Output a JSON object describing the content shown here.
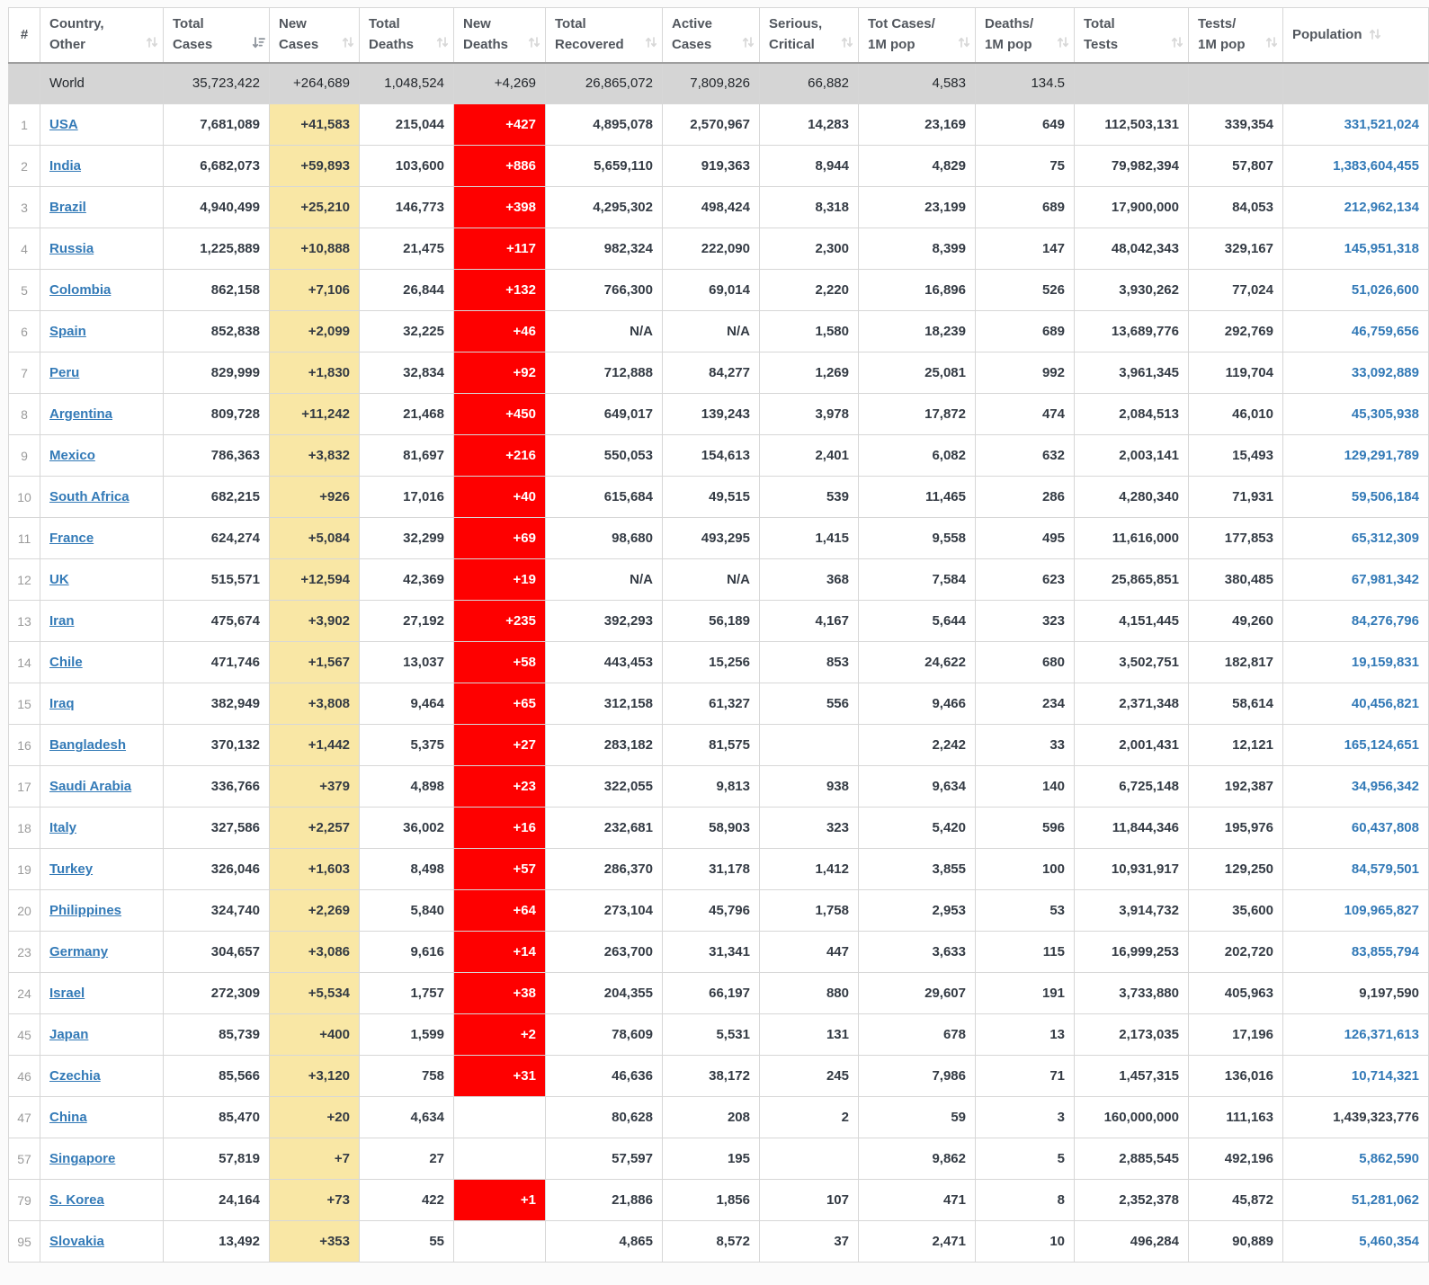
{
  "table": {
    "columns": [
      {
        "id": "rank",
        "label": "#",
        "sortable": false,
        "icon": null
      },
      {
        "id": "country",
        "label": "Country,\nOther",
        "sortable": true,
        "icon": "sort-both-icon"
      },
      {
        "id": "total_cases",
        "label": "Total\nCases",
        "sortable": true,
        "icon": "sort-desc-icon"
      },
      {
        "id": "new_cases",
        "label": "New\nCases",
        "sortable": true,
        "icon": "sort-both-icon"
      },
      {
        "id": "total_deaths",
        "label": "Total\nDeaths",
        "sortable": true,
        "icon": "sort-both-icon"
      },
      {
        "id": "new_deaths",
        "label": "New\nDeaths",
        "sortable": true,
        "icon": "sort-both-icon"
      },
      {
        "id": "total_recovered",
        "label": "Total\nRecovered",
        "sortable": true,
        "icon": "sort-both-icon"
      },
      {
        "id": "active_cases",
        "label": "Active\nCases",
        "sortable": true,
        "icon": "sort-both-icon"
      },
      {
        "id": "serious_critical",
        "label": "Serious,\nCritical",
        "sortable": true,
        "icon": "sort-both-icon"
      },
      {
        "id": "cases_per_1m",
        "label": "Tot Cases/\n1M pop",
        "sortable": true,
        "icon": "sort-both-icon"
      },
      {
        "id": "deaths_per_1m",
        "label": "Deaths/\n1M pop",
        "sortable": true,
        "icon": "sort-both-icon"
      },
      {
        "id": "total_tests",
        "label": "Total\nTests",
        "sortable": true,
        "icon": "sort-both-icon"
      },
      {
        "id": "tests_per_1m",
        "label": "Tests/\n1M pop",
        "sortable": true,
        "icon": "sort-both-icon"
      },
      {
        "id": "population",
        "label": "Population",
        "sortable": true,
        "icon": "sort-both-icon",
        "icon_inline": true
      }
    ],
    "world_row": {
      "rank": "",
      "country": "World",
      "total_cases": "35,723,422",
      "new_cases": "+264,689",
      "total_deaths": "1,048,524",
      "new_deaths": "+4,269",
      "total_recovered": "26,865,072",
      "active_cases": "7,809,826",
      "serious_critical": "66,882",
      "cases_per_1m": "4,583",
      "deaths_per_1m": "134.5",
      "total_tests": "",
      "tests_per_1m": "",
      "population": "",
      "population_is_link": false
    },
    "rows": [
      {
        "rank": "1",
        "country": "USA",
        "total_cases": "7,681,089",
        "new_cases": "+41,583",
        "total_deaths": "215,044",
        "new_deaths": "+427",
        "total_recovered": "4,895,078",
        "active_cases": "2,570,967",
        "serious_critical": "14,283",
        "cases_per_1m": "23,169",
        "deaths_per_1m": "649",
        "total_tests": "112,503,131",
        "tests_per_1m": "339,354",
        "population": "331,521,024",
        "population_is_link": true
      },
      {
        "rank": "2",
        "country": "India",
        "total_cases": "6,682,073",
        "new_cases": "+59,893",
        "total_deaths": "103,600",
        "new_deaths": "+886",
        "total_recovered": "5,659,110",
        "active_cases": "919,363",
        "serious_critical": "8,944",
        "cases_per_1m": "4,829",
        "deaths_per_1m": "75",
        "total_tests": "79,982,394",
        "tests_per_1m": "57,807",
        "population": "1,383,604,455",
        "population_is_link": true
      },
      {
        "rank": "3",
        "country": "Brazil",
        "total_cases": "4,940,499",
        "new_cases": "+25,210",
        "total_deaths": "146,773",
        "new_deaths": "+398",
        "total_recovered": "4,295,302",
        "active_cases": "498,424",
        "serious_critical": "8,318",
        "cases_per_1m": "23,199",
        "deaths_per_1m": "689",
        "total_tests": "17,900,000",
        "tests_per_1m": "84,053",
        "population": "212,962,134",
        "population_is_link": true
      },
      {
        "rank": "4",
        "country": "Russia",
        "total_cases": "1,225,889",
        "new_cases": "+10,888",
        "total_deaths": "21,475",
        "new_deaths": "+117",
        "total_recovered": "982,324",
        "active_cases": "222,090",
        "serious_critical": "2,300",
        "cases_per_1m": "8,399",
        "deaths_per_1m": "147",
        "total_tests": "48,042,343",
        "tests_per_1m": "329,167",
        "population": "145,951,318",
        "population_is_link": true
      },
      {
        "rank": "5",
        "country": "Colombia",
        "total_cases": "862,158",
        "new_cases": "+7,106",
        "total_deaths": "26,844",
        "new_deaths": "+132",
        "total_recovered": "766,300",
        "active_cases": "69,014",
        "serious_critical": "2,220",
        "cases_per_1m": "16,896",
        "deaths_per_1m": "526",
        "total_tests": "3,930,262",
        "tests_per_1m": "77,024",
        "population": "51,026,600",
        "population_is_link": true
      },
      {
        "rank": "6",
        "country": "Spain",
        "total_cases": "852,838",
        "new_cases": "+2,099",
        "total_deaths": "32,225",
        "new_deaths": "+46",
        "total_recovered": "N/A",
        "active_cases": "N/A",
        "serious_critical": "1,580",
        "cases_per_1m": "18,239",
        "deaths_per_1m": "689",
        "total_tests": "13,689,776",
        "tests_per_1m": "292,769",
        "population": "46,759,656",
        "population_is_link": true
      },
      {
        "rank": "7",
        "country": "Peru",
        "total_cases": "829,999",
        "new_cases": "+1,830",
        "total_deaths": "32,834",
        "new_deaths": "+92",
        "total_recovered": "712,888",
        "active_cases": "84,277",
        "serious_critical": "1,269",
        "cases_per_1m": "25,081",
        "deaths_per_1m": "992",
        "total_tests": "3,961,345",
        "tests_per_1m": "119,704",
        "population": "33,092,889",
        "population_is_link": true
      },
      {
        "rank": "8",
        "country": "Argentina",
        "total_cases": "809,728",
        "new_cases": "+11,242",
        "total_deaths": "21,468",
        "new_deaths": "+450",
        "total_recovered": "649,017",
        "active_cases": "139,243",
        "serious_critical": "3,978",
        "cases_per_1m": "17,872",
        "deaths_per_1m": "474",
        "total_tests": "2,084,513",
        "tests_per_1m": "46,010",
        "population": "45,305,938",
        "population_is_link": true
      },
      {
        "rank": "9",
        "country": "Mexico",
        "total_cases": "786,363",
        "new_cases": "+3,832",
        "total_deaths": "81,697",
        "new_deaths": "+216",
        "total_recovered": "550,053",
        "active_cases": "154,613",
        "serious_critical": "2,401",
        "cases_per_1m": "6,082",
        "deaths_per_1m": "632",
        "total_tests": "2,003,141",
        "tests_per_1m": "15,493",
        "population": "129,291,789",
        "population_is_link": true
      },
      {
        "rank": "10",
        "country": "South Africa",
        "total_cases": "682,215",
        "new_cases": "+926",
        "total_deaths": "17,016",
        "new_deaths": "+40",
        "total_recovered": "615,684",
        "active_cases": "49,515",
        "serious_critical": "539",
        "cases_per_1m": "11,465",
        "deaths_per_1m": "286",
        "total_tests": "4,280,340",
        "tests_per_1m": "71,931",
        "population": "59,506,184",
        "population_is_link": true
      },
      {
        "rank": "11",
        "country": "France",
        "total_cases": "624,274",
        "new_cases": "+5,084",
        "total_deaths": "32,299",
        "new_deaths": "+69",
        "total_recovered": "98,680",
        "active_cases": "493,295",
        "serious_critical": "1,415",
        "cases_per_1m": "9,558",
        "deaths_per_1m": "495",
        "total_tests": "11,616,000",
        "tests_per_1m": "177,853",
        "population": "65,312,309",
        "population_is_link": true
      },
      {
        "rank": "12",
        "country": "UK",
        "total_cases": "515,571",
        "new_cases": "+12,594",
        "total_deaths": "42,369",
        "new_deaths": "+19",
        "total_recovered": "N/A",
        "active_cases": "N/A",
        "serious_critical": "368",
        "cases_per_1m": "7,584",
        "deaths_per_1m": "623",
        "total_tests": "25,865,851",
        "tests_per_1m": "380,485",
        "population": "67,981,342",
        "population_is_link": true
      },
      {
        "rank": "13",
        "country": "Iran",
        "total_cases": "475,674",
        "new_cases": "+3,902",
        "total_deaths": "27,192",
        "new_deaths": "+235",
        "total_recovered": "392,293",
        "active_cases": "56,189",
        "serious_critical": "4,167",
        "cases_per_1m": "5,644",
        "deaths_per_1m": "323",
        "total_tests": "4,151,445",
        "tests_per_1m": "49,260",
        "population": "84,276,796",
        "population_is_link": true
      },
      {
        "rank": "14",
        "country": "Chile",
        "total_cases": "471,746",
        "new_cases": "+1,567",
        "total_deaths": "13,037",
        "new_deaths": "+58",
        "total_recovered": "443,453",
        "active_cases": "15,256",
        "serious_critical": "853",
        "cases_per_1m": "24,622",
        "deaths_per_1m": "680",
        "total_tests": "3,502,751",
        "tests_per_1m": "182,817",
        "population": "19,159,831",
        "population_is_link": true
      },
      {
        "rank": "15",
        "country": "Iraq",
        "total_cases": "382,949",
        "new_cases": "+3,808",
        "total_deaths": "9,464",
        "new_deaths": "+65",
        "total_recovered": "312,158",
        "active_cases": "61,327",
        "serious_critical": "556",
        "cases_per_1m": "9,466",
        "deaths_per_1m": "234",
        "total_tests": "2,371,348",
        "tests_per_1m": "58,614",
        "population": "40,456,821",
        "population_is_link": true
      },
      {
        "rank": "16",
        "country": "Bangladesh",
        "total_cases": "370,132",
        "new_cases": "+1,442",
        "total_deaths": "5,375",
        "new_deaths": "+27",
        "total_recovered": "283,182",
        "active_cases": "81,575",
        "serious_critical": "",
        "cases_per_1m": "2,242",
        "deaths_per_1m": "33",
        "total_tests": "2,001,431",
        "tests_per_1m": "12,121",
        "population": "165,124,651",
        "population_is_link": true
      },
      {
        "rank": "17",
        "country": "Saudi Arabia",
        "total_cases": "336,766",
        "new_cases": "+379",
        "total_deaths": "4,898",
        "new_deaths": "+23",
        "total_recovered": "322,055",
        "active_cases": "9,813",
        "serious_critical": "938",
        "cases_per_1m": "9,634",
        "deaths_per_1m": "140",
        "total_tests": "6,725,148",
        "tests_per_1m": "192,387",
        "population": "34,956,342",
        "population_is_link": true
      },
      {
        "rank": "18",
        "country": "Italy",
        "total_cases": "327,586",
        "new_cases": "+2,257",
        "total_deaths": "36,002",
        "new_deaths": "+16",
        "total_recovered": "232,681",
        "active_cases": "58,903",
        "serious_critical": "323",
        "cases_per_1m": "5,420",
        "deaths_per_1m": "596",
        "total_tests": "11,844,346",
        "tests_per_1m": "195,976",
        "population": "60,437,808",
        "population_is_link": true
      },
      {
        "rank": "19",
        "country": "Turkey",
        "total_cases": "326,046",
        "new_cases": "+1,603",
        "total_deaths": "8,498",
        "new_deaths": "+57",
        "total_recovered": "286,370",
        "active_cases": "31,178",
        "serious_critical": "1,412",
        "cases_per_1m": "3,855",
        "deaths_per_1m": "100",
        "total_tests": "10,931,917",
        "tests_per_1m": "129,250",
        "population": "84,579,501",
        "population_is_link": true
      },
      {
        "rank": "20",
        "country": "Philippines",
        "total_cases": "324,740",
        "new_cases": "+2,269",
        "total_deaths": "5,840",
        "new_deaths": "+64",
        "total_recovered": "273,104",
        "active_cases": "45,796",
        "serious_critical": "1,758",
        "cases_per_1m": "2,953",
        "deaths_per_1m": "53",
        "total_tests": "3,914,732",
        "tests_per_1m": "35,600",
        "population": "109,965,827",
        "population_is_link": true
      },
      {
        "rank": "23",
        "country": "Germany",
        "total_cases": "304,657",
        "new_cases": "+3,086",
        "total_deaths": "9,616",
        "new_deaths": "+14",
        "total_recovered": "263,700",
        "active_cases": "31,341",
        "serious_critical": "447",
        "cases_per_1m": "3,633",
        "deaths_per_1m": "115",
        "total_tests": "16,999,253",
        "tests_per_1m": "202,720",
        "population": "83,855,794",
        "population_is_link": true
      },
      {
        "rank": "24",
        "country": "Israel",
        "total_cases": "272,309",
        "new_cases": "+5,534",
        "total_deaths": "1,757",
        "new_deaths": "+38",
        "total_recovered": "204,355",
        "active_cases": "66,197",
        "serious_critical": "880",
        "cases_per_1m": "29,607",
        "deaths_per_1m": "191",
        "total_tests": "3,733,880",
        "tests_per_1m": "405,963",
        "population": "9,197,590",
        "population_is_link": false
      },
      {
        "rank": "45",
        "country": "Japan",
        "total_cases": "85,739",
        "new_cases": "+400",
        "total_deaths": "1,599",
        "new_deaths": "+2",
        "total_recovered": "78,609",
        "active_cases": "5,531",
        "serious_critical": "131",
        "cases_per_1m": "678",
        "deaths_per_1m": "13",
        "total_tests": "2,173,035",
        "tests_per_1m": "17,196",
        "population": "126,371,613",
        "population_is_link": true
      },
      {
        "rank": "46",
        "country": "Czechia",
        "total_cases": "85,566",
        "new_cases": "+3,120",
        "total_deaths": "758",
        "new_deaths": "+31",
        "total_recovered": "46,636",
        "active_cases": "38,172",
        "serious_critical": "245",
        "cases_per_1m": "7,986",
        "deaths_per_1m": "71",
        "total_tests": "1,457,315",
        "tests_per_1m": "136,016",
        "population": "10,714,321",
        "population_is_link": true
      },
      {
        "rank": "47",
        "country": "China",
        "total_cases": "85,470",
        "new_cases": "+20",
        "total_deaths": "4,634",
        "new_deaths": "",
        "total_recovered": "80,628",
        "active_cases": "208",
        "serious_critical": "2",
        "cases_per_1m": "59",
        "deaths_per_1m": "3",
        "total_tests": "160,000,000",
        "tests_per_1m": "111,163",
        "population": "1,439,323,776",
        "population_is_link": false
      },
      {
        "rank": "57",
        "country": "Singapore",
        "total_cases": "57,819",
        "new_cases": "+7",
        "total_deaths": "27",
        "new_deaths": "",
        "total_recovered": "57,597",
        "active_cases": "195",
        "serious_critical": "",
        "cases_per_1m": "9,862",
        "deaths_per_1m": "5",
        "total_tests": "2,885,545",
        "tests_per_1m": "492,196",
        "population": "5,862,590",
        "population_is_link": true
      },
      {
        "rank": "79",
        "country": "S. Korea",
        "total_cases": "24,164",
        "new_cases": "+73",
        "total_deaths": "422",
        "new_deaths": "+1",
        "total_recovered": "21,886",
        "active_cases": "1,856",
        "serious_critical": "107",
        "cases_per_1m": "471",
        "deaths_per_1m": "8",
        "total_tests": "2,352,378",
        "tests_per_1m": "45,872",
        "population": "51,281,062",
        "population_is_link": true
      },
      {
        "rank": "95",
        "country": "Slovakia",
        "total_cases": "13,492",
        "new_cases": "+353",
        "total_deaths": "55",
        "new_deaths": "",
        "total_recovered": "4,865",
        "active_cases": "8,572",
        "serious_critical": "37",
        "cases_per_1m": "2,471",
        "deaths_per_1m": "10",
        "total_tests": "496,284",
        "tests_per_1m": "90,889",
        "population": "5,460,354",
        "population_is_link": true
      }
    ],
    "colors": {
      "new_cases_highlight": "#f9e7a5",
      "new_deaths_highlight": "#fe0000",
      "world_row_bg": "#d5d5d5",
      "link_blue": "#337ab7"
    }
  }
}
